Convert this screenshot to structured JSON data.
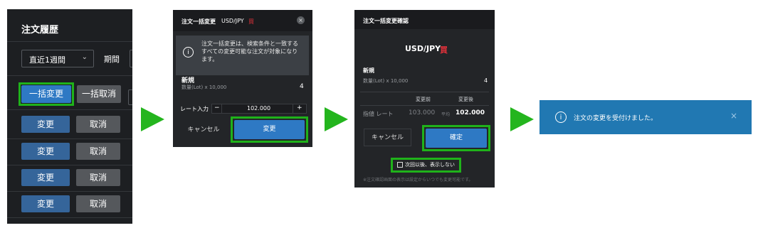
{
  "step1": {
    "title": "注文履歴",
    "period_select": "直近1週間",
    "period_label": "期間",
    "bulk_change": "一括変更",
    "bulk_cancel": "一括取消",
    "rows": [
      {
        "change": "変更",
        "cancel": "取消"
      },
      {
        "change": "変更",
        "cancel": "取消"
      },
      {
        "change": "変更",
        "cancel": "取消"
      },
      {
        "change": "変更",
        "cancel": "取消"
      }
    ]
  },
  "step2": {
    "title": "注文一括変更",
    "pair": "USD/JPY",
    "side": "買",
    "close_icon": "close-icon",
    "info_text": "注文一括変更は、検索条件と一致する すべての変更可能な注文が対象になり ます。",
    "section": "新規",
    "qty_label": "数量(Lot) x 10,000",
    "qty_value": "4",
    "rate_label": "レート入力",
    "rate_value": "102.000",
    "minus": "−",
    "plus": "+",
    "cancel_btn": "キャンセル",
    "change_btn": "変更"
  },
  "step3": {
    "title": "注文一括変更確認",
    "pair": "USD/JPY",
    "side": "買",
    "section": "新規",
    "qty_label": "数量(Lot) x 10,000",
    "qty_value": "4",
    "col_before": "変更前",
    "col_after": "変更後",
    "rate_label": "指値 レート",
    "rate_before": "103.000",
    "rate_before_unit": "平均",
    "rate_after": "102.000",
    "cancel_btn": "キャンセル",
    "confirm_btn": "確定",
    "checkbox_label": "次回以後、表示しない",
    "footnote": "※注文確認画面の表示は設定からいつでも変更可能です。"
  },
  "step4": {
    "message": "注文の変更を受付けました。",
    "close": "×"
  },
  "colors": {
    "highlight": "#1fb21a",
    "arrow": "#24b51e",
    "toast": "#2178b2",
    "buy_red": "#e0313a"
  }
}
